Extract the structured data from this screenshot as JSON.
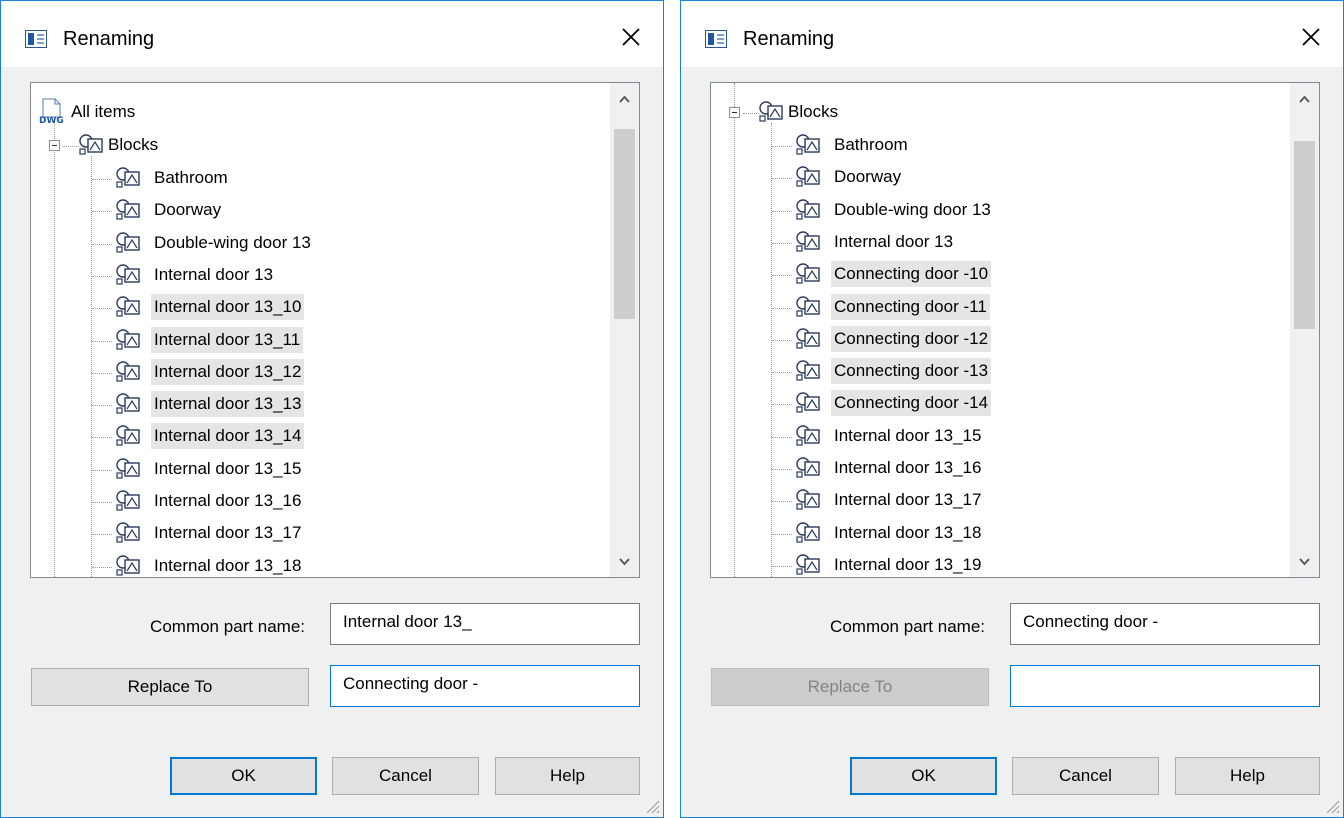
{
  "dialogs": [
    {
      "title": "Renaming",
      "tree": {
        "root": "All items",
        "group": "Blocks",
        "items": [
          {
            "label": "Bathroom",
            "selected": false
          },
          {
            "label": "Doorway",
            "selected": false
          },
          {
            "label": "Double-wing door 13",
            "selected": false
          },
          {
            "label": "Internal door 13",
            "selected": false
          },
          {
            "label": "Internal door 13_10",
            "selected": true
          },
          {
            "label": "Internal door 13_11",
            "selected": true
          },
          {
            "label": "Internal door 13_12",
            "selected": true
          },
          {
            "label": "Internal door 13_13",
            "selected": true
          },
          {
            "label": "Internal door 13_14",
            "selected": true
          },
          {
            "label": "Internal door 13_15",
            "selected": false
          },
          {
            "label": "Internal door 13_16",
            "selected": false
          },
          {
            "label": "Internal door 13_17",
            "selected": false
          },
          {
            "label": "Internal door 13_18",
            "selected": false
          }
        ]
      },
      "common_label": "Common part name:",
      "common_value": "Internal door 13_",
      "replace_button": "Replace To",
      "replace_enabled": true,
      "replace_value": "Connecting door -",
      "ok": "OK",
      "cancel": "Cancel",
      "help": "Help"
    },
    {
      "title": "Renaming",
      "tree": {
        "root": "",
        "group": "Blocks",
        "items": [
          {
            "label": "Bathroom",
            "selected": false
          },
          {
            "label": "Doorway",
            "selected": false
          },
          {
            "label": "Double-wing door 13",
            "selected": false
          },
          {
            "label": "Internal door 13",
            "selected": false
          },
          {
            "label": "Connecting door -10",
            "selected": true
          },
          {
            "label": "Connecting door -11",
            "selected": true
          },
          {
            "label": "Connecting door -12",
            "selected": true
          },
          {
            "label": "Connecting door -13",
            "selected": true
          },
          {
            "label": "Connecting door -14",
            "selected": true
          },
          {
            "label": "Internal door 13_15",
            "selected": false
          },
          {
            "label": "Internal door 13_16",
            "selected": false
          },
          {
            "label": "Internal door 13_17",
            "selected": false
          },
          {
            "label": "Internal door 13_18",
            "selected": false
          },
          {
            "label": "Internal door 13_19",
            "selected": false
          }
        ]
      },
      "common_label": "Common part name:",
      "common_value": "Connecting door -",
      "replace_button": "Replace To",
      "replace_enabled": false,
      "replace_value": "",
      "ok": "OK",
      "cancel": "Cancel",
      "help": "Help"
    }
  ]
}
